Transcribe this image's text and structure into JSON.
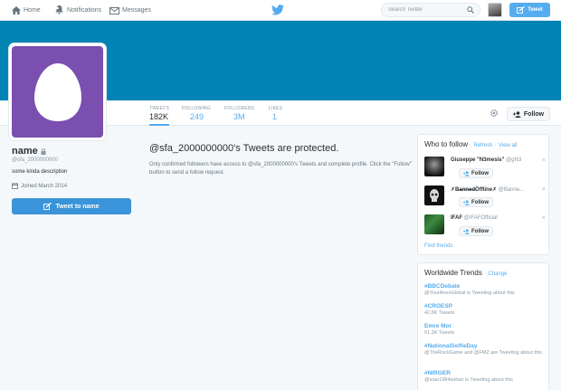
{
  "nav": {
    "home": "Home",
    "notifications": "Notifications",
    "notifications_badge": "",
    "messages": "Messages",
    "search_placeholder": "Search Twitter",
    "tweet_button": "Tweet"
  },
  "colors": {
    "accent": "#55acee",
    "banner": "#0084b4",
    "avatar_bg": "#7a4fb0"
  },
  "stats": [
    {
      "label": "TWEETS",
      "value": "182K"
    },
    {
      "label": "FOLLOWING",
      "value": "249"
    },
    {
      "label": "FOLLOWERS",
      "value": "3M"
    },
    {
      "label": "LIKES",
      "value": "1"
    }
  ],
  "follow_button": "Follow",
  "profile": {
    "name": "name",
    "handle": "@sfa_2000000000",
    "bio": "some kinda description",
    "joined": "Joined March 2014",
    "tweet_to": "Tweet to name"
  },
  "protected": {
    "title": "@sfa_2000000000's Tweets are protected.",
    "body": "Only confirmed followers have access to @sfa_2000000000's Tweets and complete profile. Click the \"Follow\" button to send a follow request."
  },
  "who_to_follow": {
    "title": "Who to follow",
    "refresh": "Refresh",
    "view_all": "View all",
    "dot": "·",
    "follow_label": "Follow",
    "close": "×",
    "suggestions": [
      {
        "name": "Giuseppe \"N3mesis\"",
        "handle": "@gN3"
      },
      {
        "name": "✗B̶a̶n̶n̶e̶d̶Öffline✗",
        "handle": "@Banne..."
      },
      {
        "name": "IFAF",
        "handle": "@IFAFOfficial"
      }
    ],
    "find_friends": "Find friends"
  },
  "trends": {
    "title": "Worldwide Trends",
    "change": "Change",
    "dot": "·",
    "items": [
      {
        "name": "#BBCDebate",
        "desc": "@YourAnonGlobal is Tweeting about this"
      },
      {
        "name": "#CROESP",
        "desc": "42.6K Tweets"
      },
      {
        "name": "Emre Mor",
        "desc": "51.2K Tweets"
      },
      {
        "name": "#NationalSelfieDay",
        "desc": "@TheRockGame and @FMZ are Tweeting about this"
      },
      {
        "name": "#NIRGER",
        "desc": "@soar1984ashan is Tweeting about this"
      }
    ]
  }
}
